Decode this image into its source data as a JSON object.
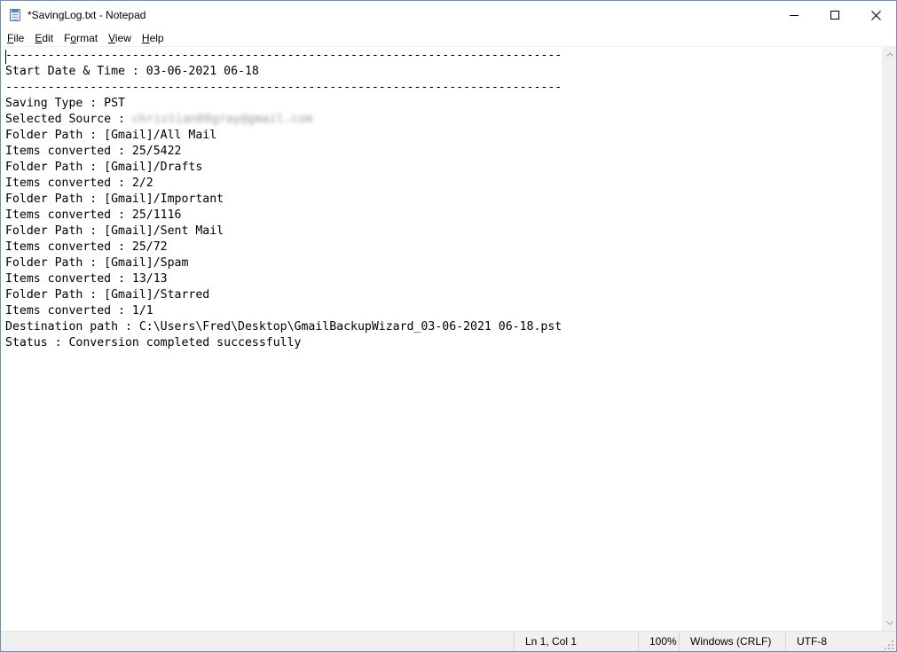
{
  "window": {
    "title": "*SavingLog.txt - Notepad",
    "icon": "notepad-icon",
    "controls": [
      "minimize-icon",
      "maximize-icon",
      "close-icon"
    ]
  },
  "menu": {
    "items": [
      {
        "label": "File",
        "accel": "F",
        "rest": "ile"
      },
      {
        "label": "Edit",
        "accel": "E",
        "rest": "dit"
      },
      {
        "label": "Format",
        "accel": "o",
        "pre": "F",
        "rest": "rmat"
      },
      {
        "label": "View",
        "accel": "V",
        "rest": "iew"
      },
      {
        "label": "Help",
        "accel": "H",
        "rest": "elp"
      }
    ]
  },
  "document": {
    "lines": [
      "-------------------------------------------------------------------------------",
      "Start Date & Time : 03-06-2021 06-18",
      "-------------------------------------------------------------------------------",
      "Saving Type : PST",
      "Selected Source : ",
      "Folder Path : [Gmail]/All Mail",
      "Items converted : 25/5422",
      "Folder Path : [Gmail]/Drafts",
      "Items converted : 2/2",
      "Folder Path : [Gmail]/Important",
      "Items converted : 25/1116",
      "Folder Path : [Gmail]/Sent Mail",
      "Items converted : 25/72",
      "Folder Path : [Gmail]/Spam",
      "Items converted : 13/13",
      "Folder Path : [Gmail]/Starred",
      "Items converted : 1/1",
      "Destination path : C:\\Users\\Fred\\Desktop\\GmailBackupWizard_03-06-2021 06-18.pst",
      "Status : Conversion completed successfully"
    ],
    "redacted_source": "christian00gray@gmail.com"
  },
  "status": {
    "position": "Ln 1, Col 1",
    "zoom": "100%",
    "line_endings": "Windows (CRLF)",
    "encoding": "UTF-8"
  },
  "colors": {
    "window_border": "#6b8fb7",
    "statusbar_bg": "#f0f0f0",
    "scrollbar_bg": "#f0f0f0"
  }
}
